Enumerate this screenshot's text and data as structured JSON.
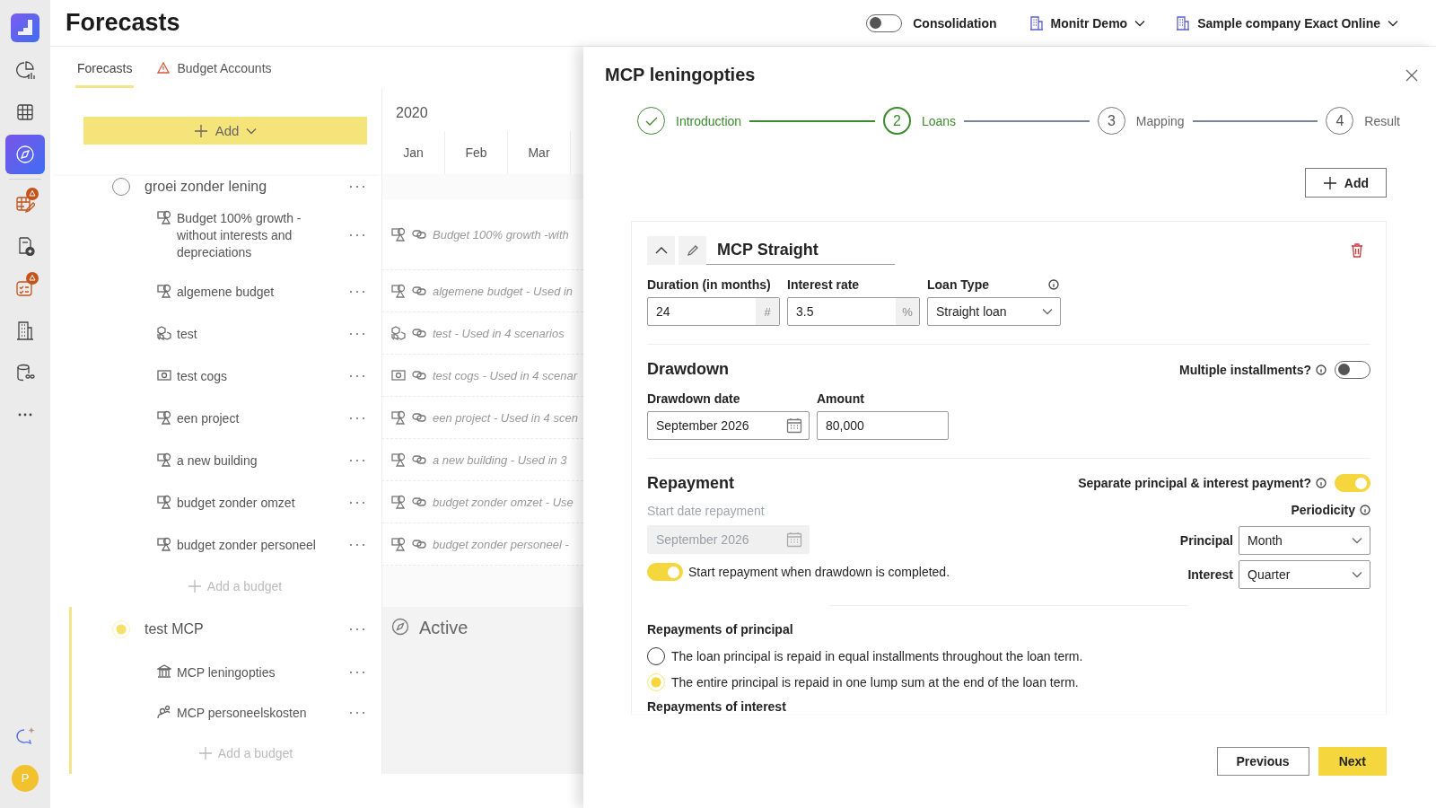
{
  "rail": {
    "items": [
      {
        "kind": "logo",
        "selected": false,
        "badge": false
      },
      {
        "kind": "chart",
        "selected": false,
        "badge": false
      },
      {
        "kind": "grid",
        "selected": false,
        "badge": false
      },
      {
        "kind": "compass",
        "selected": true,
        "badge": false
      },
      {
        "kind": "sheet",
        "selected": false,
        "badge": true
      },
      {
        "kind": "doc-add",
        "selected": false,
        "badge": false
      },
      {
        "kind": "checklist",
        "selected": false,
        "badge": true
      },
      {
        "kind": "building",
        "selected": false,
        "badge": false
      },
      {
        "kind": "database",
        "selected": false,
        "badge": false
      },
      {
        "kind": "more",
        "selected": false,
        "badge": false
      }
    ],
    "bottom": [
      {
        "kind": "chat"
      }
    ],
    "avatar": "P"
  },
  "header": {
    "title": "Forecasts",
    "consolidation": {
      "label": "Consolidation",
      "on": false
    },
    "selectors": [
      {
        "label": "Monitr Demo"
      },
      {
        "label": "Sample company Exact Online"
      }
    ]
  },
  "background": {
    "tabs": [
      {
        "label": "Forecasts",
        "selected": true,
        "warning": false
      },
      {
        "label": "Budget Accounts",
        "selected": false,
        "warning": true
      }
    ],
    "add_button": "Add",
    "year": "2020",
    "months": [
      "Jan",
      "Feb",
      "Mar"
    ],
    "groups": [
      {
        "name": "groei zonder lening",
        "selected": false,
        "add_label": "Add a budget",
        "items": [
          {
            "kind": "scenario",
            "name": "Budget 100% growth - without interests and depreciations",
            "timeline": "Budget 100% growth -with"
          },
          {
            "kind": "scenario",
            "name": "algemene budget",
            "timeline": "algemene budget - Used in"
          },
          {
            "kind": "cubes",
            "name": "test",
            "timeline": "test - Used in 4 scenarios"
          },
          {
            "kind": "money",
            "name": "test cogs",
            "timeline": "test cogs - Used in 4 scenar"
          },
          {
            "kind": "scenario",
            "name": "een project",
            "timeline": "een project - Used in 4 scen"
          },
          {
            "kind": "scenario",
            "name": "a new building",
            "timeline": "a new building - Used in 3"
          },
          {
            "kind": "scenario",
            "name": "budget zonder omzet",
            "timeline": "budget zonder omzet - Use"
          },
          {
            "kind": "scenario",
            "name": "budget zonder personeel",
            "timeline": "budget zonder personeel -"
          }
        ]
      },
      {
        "name": "test MCP",
        "selected": true,
        "status": "Active",
        "add_label": "Add a budget",
        "items": [
          {
            "kind": "bank",
            "name": "MCP leningopties"
          },
          {
            "kind": "people",
            "name": "MCP personeelskosten"
          }
        ]
      }
    ]
  },
  "panel": {
    "title": "MCP leningopties",
    "steps": [
      {
        "label": "Introduction",
        "completed": true,
        "selected": false
      },
      {
        "number": "2",
        "label": "Loans",
        "completed": false,
        "selected": true
      },
      {
        "number": "3",
        "label": "Mapping",
        "completed": false,
        "selected": false
      },
      {
        "number": "4",
        "label": "Result",
        "completed": false,
        "selected": false
      }
    ],
    "add_button": "Add",
    "loan": {
      "expanded": true,
      "name": "MCP Straight",
      "fields": [
        {
          "label": "Duration (in months)",
          "value": "24",
          "suffix": "#"
        },
        {
          "label": "Interest rate",
          "value": "3.5",
          "suffix": "%"
        }
      ],
      "loan_type": {
        "label": "Loan Type",
        "value": "Straight loan"
      },
      "drawdown": {
        "heading": "Drawdown",
        "multiple": {
          "label": "Multiple installments?",
          "on": false
        },
        "date": {
          "label": "Drawdown date",
          "value": "September 2026"
        },
        "amount": {
          "label": "Amount",
          "value": "80,000"
        }
      },
      "repayment": {
        "heading": "Repayment",
        "separate": {
          "label": "Separate principal & interest payment?",
          "on": true
        },
        "start_date": {
          "label": "Start date repayment",
          "value": "September 2026",
          "disabled": true
        },
        "start_toggle": {
          "label": "Start repayment when drawdown is completed.",
          "on": true
        },
        "periodicity": {
          "label": "Periodicity",
          "rows": [
            {
              "label": "Principal",
              "value": "Month"
            },
            {
              "label": "Interest",
              "value": "Quarter"
            }
          ]
        }
      },
      "principal": {
        "heading": "Repayments of principal",
        "options": [
          {
            "label": "The loan principal is repaid in equal installments throughout the loan term.",
            "selected": false
          },
          {
            "label": "The entire principal is repaid in one lump sum at the end of the loan term.",
            "selected": true
          }
        ]
      },
      "interest_heading": "Repayments of interest"
    },
    "footer": [
      {
        "label": "Previous",
        "kind": "secondary"
      },
      {
        "label": "Next",
        "kind": "primary"
      }
    ]
  }
}
